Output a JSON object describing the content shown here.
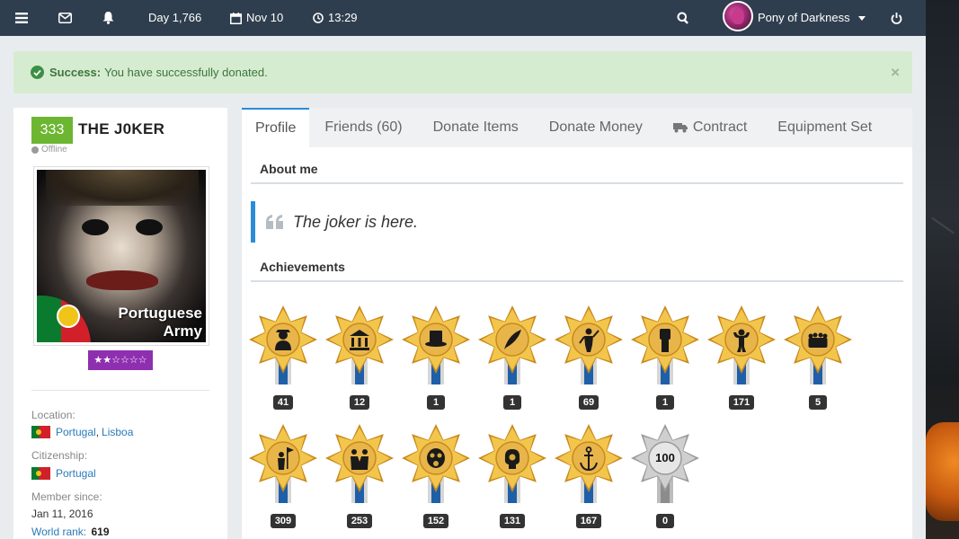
{
  "topbar": {
    "day": "Day 1,766",
    "date": "Nov 10",
    "time": "13:29",
    "username": "Pony of Darkness",
    "icons": [
      "menu-icon",
      "mail-icon",
      "bell-icon",
      "calendar-icon",
      "clock-icon",
      "search-icon",
      "power-icon"
    ]
  },
  "alert": {
    "title": "Success:",
    "message": "You have successfully donated.",
    "close": "×"
  },
  "profile": {
    "level": "333",
    "name": "THE J0KER",
    "status": "Offline",
    "avatar_text_line1": "Portuguese",
    "avatar_text_line2": "Army",
    "stars": "★★☆☆☆☆",
    "location_label": "Location:",
    "location_country": "Portugal",
    "location_region": "Lisboa",
    "citizenship_label": "Citizenship:",
    "citizenship_value": "Portugal",
    "member_since_label": "Member since:",
    "member_since_value": "Jan 11, 2016",
    "world_rank_label": "World rank:",
    "world_rank_value": "619"
  },
  "tabs": [
    {
      "label": "Profile"
    },
    {
      "label": "Friends (60)"
    },
    {
      "label": "Donate Items"
    },
    {
      "label": "Donate Money"
    },
    {
      "label": "Contract"
    },
    {
      "label": "Equipment Set"
    }
  ],
  "about": {
    "title": "About me",
    "quote": "The joker is here."
  },
  "achievements": {
    "title": "Achievements",
    "row1": [
      {
        "icon": "worker-icon",
        "count": "41"
      },
      {
        "icon": "bank-icon",
        "count": "12"
      },
      {
        "icon": "top-hat-icon",
        "count": "1"
      },
      {
        "icon": "quill-icon",
        "count": "1"
      },
      {
        "icon": "soldier-icon",
        "count": "69"
      },
      {
        "icon": "fist-icon",
        "count": "1"
      },
      {
        "icon": "strongman-icon",
        "count": "171"
      },
      {
        "icon": "group-icon",
        "count": "5"
      }
    ],
    "row2": [
      {
        "icon": "flag-bearer-icon",
        "count": "309"
      },
      {
        "icon": "handshake-icon",
        "count": "253"
      },
      {
        "icon": "gas-mask-icon",
        "count": "152"
      },
      {
        "icon": "brain-icon",
        "count": "131"
      },
      {
        "icon": "anchor-icon",
        "count": "167"
      },
      {
        "icon": "hundred-icon",
        "count": "0",
        "badge_text": "100"
      }
    ]
  },
  "colors": {
    "topbar": "#2f3e4e",
    "alert_bg": "#d6ecd0",
    "level_badge": "#6cb632",
    "stars_badge": "#8e2fb0",
    "active_tab_accent": "#2a8cd8",
    "link": "#2a7ab8"
  }
}
